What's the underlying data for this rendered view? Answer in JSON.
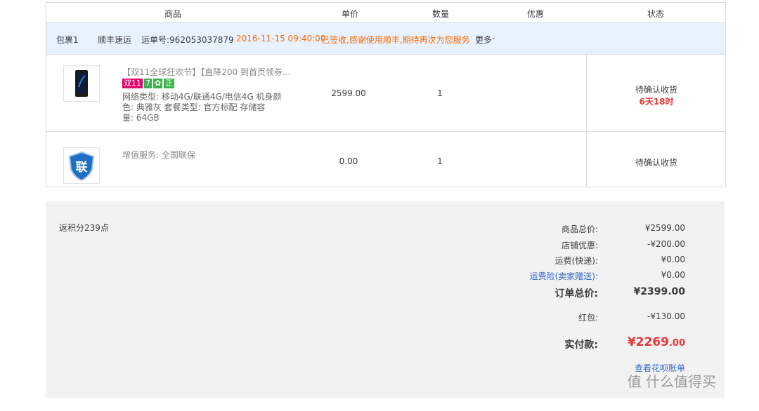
{
  "header": {
    "product": "商品",
    "unit_price": "单价",
    "quantity": "数量",
    "discount": "优惠",
    "status": "状态"
  },
  "package": {
    "name": "包裹1",
    "carrier": "顺丰速运",
    "tracking": "运单号:962053037879",
    "time": "2016-11-15 09:40:00",
    "message": "已签收,感谢使用顺丰,期待再次为您服务",
    "more": "更多"
  },
  "items": [
    {
      "title": "【双11全球狂欢节】【直降200 到首页领券...",
      "badges": [
        "双11",
        "7",
        "✿",
        "正"
      ],
      "spec_lines": [
        "网络类型: 移动4G/联通4G/电信4G  机身颜",
        "色: 典雅灰  套餐类型: 官方标配  存储容",
        "量: 64GB"
      ],
      "price": "2599.00",
      "qty": "1",
      "status": "待确认收货",
      "countdown": "6天18时",
      "icon": "phone-thumbnail"
    },
    {
      "title": "增值服务: 全国联保",
      "price": "0.00",
      "qty": "1",
      "status": "待确认收货",
      "icon": "shield-thumbnail",
      "icon_text": "联"
    }
  ],
  "summary": {
    "points": "返积分239点",
    "goods_total_label": "商品总价:",
    "goods_total": "¥2599.00",
    "shop_discount_label": "店铺优惠:",
    "shop_discount": "-¥200.00",
    "shipping_label": "运费(快递):",
    "shipping": "¥0.00",
    "insurance_label": "运费险(卖家赠送):",
    "insurance": "¥0.00",
    "order_total_label": "订单总价:",
    "order_total": "¥2399.00",
    "red_packet_label": "红包:",
    "red_packet": "-¥130.00",
    "paid_label": "实付款:",
    "paid_main": "¥2269",
    "paid_decimal": ".00",
    "huabei_link": "查看花呗账单"
  },
  "watermark": "值 什么值得买",
  "colors": {
    "accent_orange": "#f56a00",
    "price_red": "#e4393c",
    "link_blue": "#3366cc",
    "package_bg": "#e8f2ff"
  }
}
